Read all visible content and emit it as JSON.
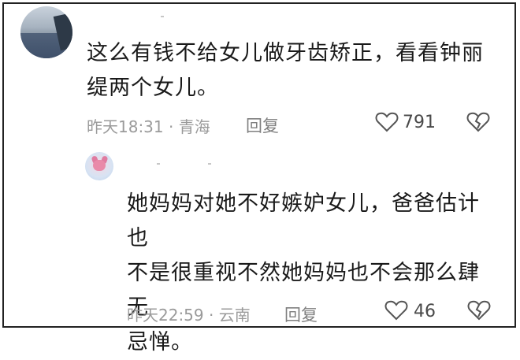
{
  "comments": [
    {
      "text_line1": "这么有钱不给女儿做牙齿矫正，看看钟丽",
      "text_line2": "缇两个女儿。",
      "time": "昨天18:31",
      "separator": "·",
      "location": "青海",
      "reply_label": "回复",
      "like_count": "791"
    },
    {
      "text_line1": "她妈妈对她不好嫉妒女儿，爸爸估计也",
      "text_line2": "不是很重视不然她妈妈也不会那么肆无",
      "text_line3": "忌惮。",
      "time": "昨天22:59",
      "separator": "·",
      "location": "云南",
      "reply_label": "回复",
      "like_count": "46"
    }
  ],
  "icons": {
    "like": "heart-outline-icon",
    "dislike": "broken-heart-outline-icon"
  },
  "colors": {
    "meta": "#9a9a9a",
    "text": "#1a1a1a",
    "frame": "#222222"
  }
}
